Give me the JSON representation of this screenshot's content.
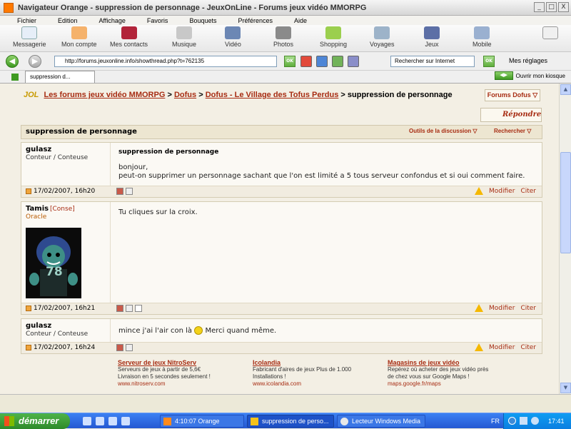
{
  "window": {
    "title": "Navigateur Orange  -  suppression de personnage - JeuxOnLine - Forums jeux vidéo MMORPG",
    "min": "_",
    "max": "□",
    "close": "X"
  },
  "menu": [
    "Fichier",
    "Edition",
    "Affichage",
    "Favoris",
    "Bouquets",
    "Préférences",
    "Aide"
  ],
  "toolbar": {
    "messagerie": "Messagerie",
    "compte": "Mon compte",
    "contacts": "Mes contacts",
    "musique": "Musique",
    "video": "Vidéo",
    "photos": "Photos",
    "shopping": "Shopping",
    "voyages": "Voyages",
    "jeux": "Jeux",
    "mobile": "Mobile"
  },
  "nav": {
    "url": "http://forums.jeuxonline.info/showthread.php?t=762135",
    "ok": "OK",
    "search_placeholder": "Rechercher sur Internet",
    "settings": "Mes réglages"
  },
  "tabs": {
    "active": "suppression d...",
    "kiosque": "Ouvrir mon kiosque"
  },
  "breadcrumb": {
    "logo": "JOL",
    "l1": "Les forums jeux vidéo MMORPG",
    "sep": ">",
    "l2": "Dofus",
    "l3": "Dofus - Le Village des Tofus Perdus",
    "current": "suppression de personnage"
  },
  "forums_button": "Forums Dofus",
  "reply_button": "Répondre",
  "thread": {
    "title": "suppression de personnage",
    "tools": "Outils de la discussion",
    "search": "Rechercher"
  },
  "posts": [
    {
      "user": "gulasz",
      "rank": "Conteur / Conteuse",
      "title": "suppression de personnage",
      "lines": [
        "bonjour,",
        "peut-on supprimer un personnage sachant que l'on est limité a 5 tous serveur confondus et si oui comment faire."
      ],
      "date": "17/02/2007, 16h20",
      "modifier": "Modifier",
      "citer": "Citer"
    },
    {
      "user": "Tamis",
      "conse": "[Conse]",
      "rank": "Oracle",
      "avatar_text": "78",
      "lines": [
        "Tu cliques sur la croix."
      ],
      "date": "17/02/2007, 16h21",
      "modifier": "Modifier",
      "citer": "Citer"
    },
    {
      "user": "gulasz",
      "rank": "Conteur / Conteuse",
      "lines_before": "mince j'ai l'air con là",
      "lines_after": "Merci quand même.",
      "date": "17/02/2007, 16h24",
      "modifier": "Modifier",
      "citer": "Citer"
    }
  ],
  "ads": [
    {
      "title": "Serveur de jeux NitroServ",
      "l1": "Serveurs de jeux à partir de 5,6€",
      "l2": "Livraison en 5 secondes seulement !",
      "url": "www.nitroserv.com"
    },
    {
      "title": "Icolandia",
      "l1": "Fabricant d'aires de jeux Plus de 1.000",
      "l2": "Installations !",
      "url": "www.icolandia.com"
    },
    {
      "title": "Magasins de jeux vidéo",
      "l1": "Repérez où acheter des jeux vidéo près",
      "l2": "de chez vous sur Google Maps !",
      "url": "maps.google.fr/maps"
    }
  ],
  "taskbar": {
    "start": "démarrer",
    "tasks": [
      "4:10:07 Orange",
      "suppression de perso...",
      "Lecteur Windows Media"
    ],
    "lang": "FR",
    "clock": "17:41"
  }
}
